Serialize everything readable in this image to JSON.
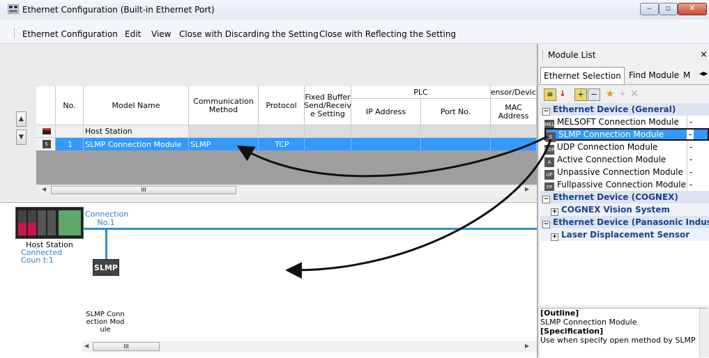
{
  "window": {
    "title": "Ethernet Configuration (Built-in Ethernet Port)",
    "minimize": "‒",
    "maximize": "▫",
    "close": "✕"
  },
  "menu": [
    "Ethernet Configuration",
    "Edit",
    "View",
    "Close with Discarding the Setting",
    "Close with Reflecting the Setting"
  ],
  "table": {
    "headers": {
      "no": "No.",
      "model_name": "Model Name",
      "comm_method": "Communication Method",
      "protocol": "Protocol",
      "fixed_buffer": "Fixed Buffer Send/Receiv e Setting",
      "plc": "PLC",
      "ip_address": "IP Address",
      "port_no": "Port No.",
      "sensor_device": "ensor/Devic",
      "mac_address": "MAC Address"
    },
    "rows": [
      {
        "no": "",
        "model_name": "Host Station",
        "comm_method": "",
        "protocol": ""
      },
      {
        "no": "1",
        "model_name": "SLMP Connection Module",
        "comm_method": "SLMP",
        "protocol": "TCP"
      }
    ],
    "scroll_thumb": "III"
  },
  "diagram": {
    "connection_label": "Connection No.1",
    "host_label": "Host Station",
    "connected_count": "Connected Coun t:1",
    "device_box_label": "SLMP",
    "device_label": "SLMP Conn ection Mod ule",
    "scroll_thumb": "III"
  },
  "module_list": {
    "title": "Module List",
    "close": "×",
    "tabs": [
      "Ethernet Selection",
      "Find Module",
      "M"
    ],
    "categories": [
      {
        "label": "Ethernet Device (General)",
        "expander": "−"
      },
      {
        "label": "Ethernet Device (COGNEX)",
        "expander": "−"
      },
      {
        "label": "Ethernet Device (Panasonic Industria",
        "expander": "−"
      }
    ],
    "general_items": [
      {
        "icon": "MEL",
        "label": "MELSOFT Connection Module",
        "value": "-"
      },
      {
        "icon": "S",
        "label": "SLMP Connection Module",
        "value": "-"
      },
      {
        "icon": "UDP",
        "label": "UDP Connection Module",
        "value": "-"
      },
      {
        "icon": "A",
        "label": "Active Connection Module",
        "value": "-"
      },
      {
        "icon": "UP",
        "label": "Unpassive Connection Module",
        "value": "-"
      },
      {
        "icon": "FP",
        "label": "Fullpassive Connection Module",
        "value": "-"
      }
    ],
    "cognex_items": [
      {
        "label": "COGNEX Vision System",
        "expander": "+"
      }
    ],
    "panasonic_items": [
      {
        "label": "Laser Displacement Sensor",
        "expander": "+"
      }
    ]
  },
  "outline": {
    "outline_heading": "[Outline]",
    "outline_text": "SLMP Connection Module",
    "spec_heading": "[Specification]",
    "spec_text": "Use when specify open method by SLMP"
  },
  "colors": {
    "selection": "#3399ff",
    "connection_line": "#2f8fd6",
    "category_text": "#1c3f8f"
  }
}
